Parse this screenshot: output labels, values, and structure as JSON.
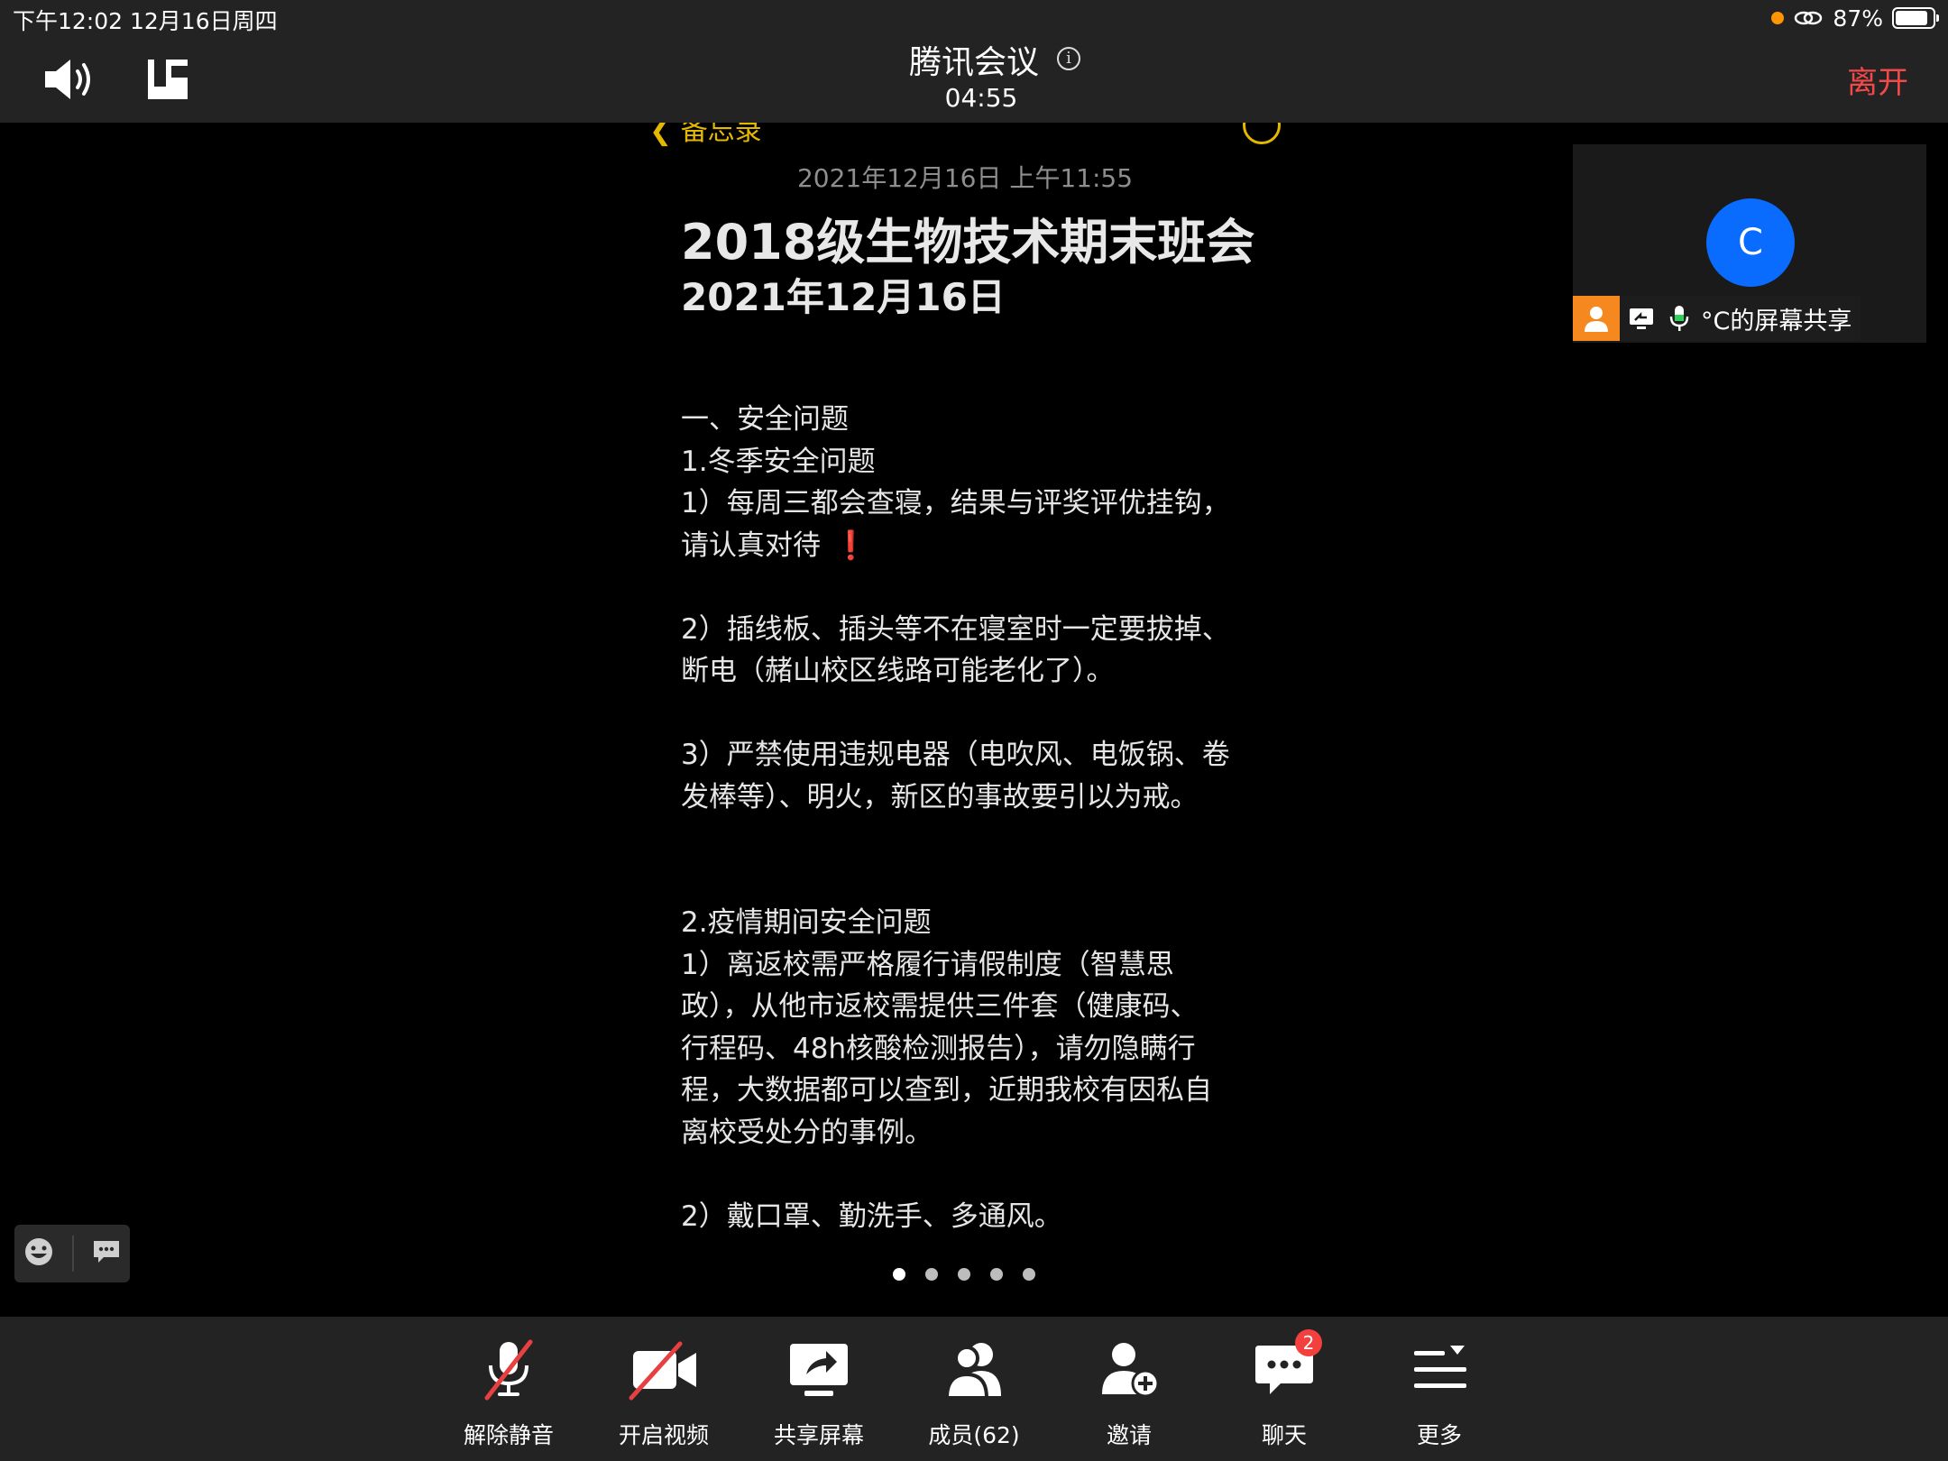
{
  "status_bar": {
    "time_date": "下午12:02   12月16日周四",
    "battery_percent": "87%",
    "battery_level": 0.87
  },
  "header": {
    "title": "腾讯会议",
    "info_icon": "i",
    "timer": "04:55",
    "leave_label": "离开"
  },
  "shared_screen": {
    "back_label": "备忘录",
    "note_date": "2021年12月16日 上午11:55",
    "note_title": "2018级生物技术期末班会",
    "note_subtitle": "2021年12月16日",
    "lines": [
      "一、安全问题",
      "1.冬季安全问题",
      "1）每周三都会查寝，结果与评奖评优挂钩，",
      "请认真对待",
      "2）插线板、插头等不在寝室时一定要拔掉、",
      "断电（赭山校区线路可能老化了）。",
      "3）严禁使用违规电器（电吹风、电饭锅、卷",
      "发棒等）、明火，新区的事故要引以为戒。",
      "2.疫情期间安全问题",
      "1）离返校需严格履行请假制度（智慧思",
      "政），从他市返校需提供三件套（健康码、",
      "行程码、48h核酸检测报告），请勿隐瞒行",
      "程，大数据都可以查到，近期我校有因私自",
      "离校受处分的事例。",
      "2）戴口罩、勤洗手、多通风。"
    ],
    "exclaim": "❗",
    "page_count": 5,
    "active_page": 1
  },
  "participant_tile": {
    "avatar_letter": "C",
    "label": "°C的屏幕共享"
  },
  "toolbar": {
    "unmute": "解除静音",
    "start_video": "开启视频",
    "share_screen": "共享屏幕",
    "members": "成员(62)",
    "invite": "邀请",
    "chat": "聊天",
    "chat_badge": "2",
    "more": "更多"
  },
  "colors": {
    "bar_bg": "#232323",
    "leave": "#f24a4a",
    "notes_accent": "#e5b800",
    "avatar_blue": "#0a6cff",
    "host_orange": "#f5891f",
    "badge_red": "#f43f3f"
  }
}
